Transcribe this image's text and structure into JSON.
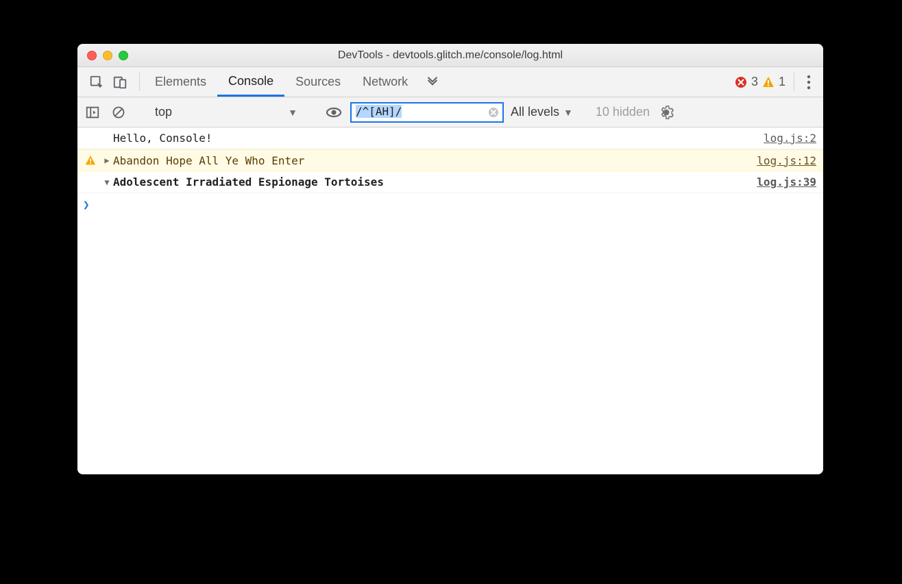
{
  "window": {
    "title": "DevTools - devtools.glitch.me/console/log.html"
  },
  "tabs": {
    "items": [
      {
        "label": "Elements",
        "active": false
      },
      {
        "label": "Console",
        "active": true
      },
      {
        "label": "Sources",
        "active": false
      },
      {
        "label": "Network",
        "active": false
      }
    ],
    "error_count": "3",
    "warning_count": "1"
  },
  "filter": {
    "context": "top",
    "filter_value": "/^[AH]/",
    "levels_label": "All levels",
    "hidden_label": "10 hidden"
  },
  "logs": [
    {
      "type": "plain",
      "msg": "Hello, Console!",
      "src": "log.js:2"
    },
    {
      "type": "warn",
      "msg": "Abandon Hope All Ye Who Enter",
      "src": "log.js:12"
    },
    {
      "type": "group",
      "msg": "Adolescent Irradiated Espionage Tortoises",
      "src": "log.js:39"
    }
  ]
}
